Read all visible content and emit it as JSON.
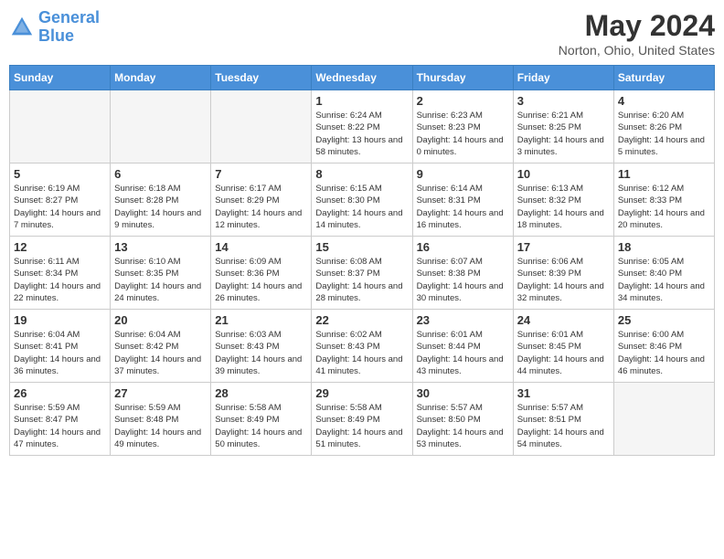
{
  "logo": {
    "line1": "General",
    "line2": "Blue"
  },
  "title": "May 2024",
  "location": "Norton, Ohio, United States",
  "headers": [
    "Sunday",
    "Monday",
    "Tuesday",
    "Wednesday",
    "Thursday",
    "Friday",
    "Saturday"
  ],
  "weeks": [
    [
      {
        "day": "",
        "sunrise": "",
        "sunset": "",
        "daylight": "",
        "empty": true
      },
      {
        "day": "",
        "sunrise": "",
        "sunset": "",
        "daylight": "",
        "empty": true
      },
      {
        "day": "",
        "sunrise": "",
        "sunset": "",
        "daylight": "",
        "empty": true
      },
      {
        "day": "1",
        "sunrise": "Sunrise: 6:24 AM",
        "sunset": "Sunset: 8:22 PM",
        "daylight": "Daylight: 13 hours and 58 minutes."
      },
      {
        "day": "2",
        "sunrise": "Sunrise: 6:23 AM",
        "sunset": "Sunset: 8:23 PM",
        "daylight": "Daylight: 14 hours and 0 minutes."
      },
      {
        "day": "3",
        "sunrise": "Sunrise: 6:21 AM",
        "sunset": "Sunset: 8:25 PM",
        "daylight": "Daylight: 14 hours and 3 minutes."
      },
      {
        "day": "4",
        "sunrise": "Sunrise: 6:20 AM",
        "sunset": "Sunset: 8:26 PM",
        "daylight": "Daylight: 14 hours and 5 minutes."
      }
    ],
    [
      {
        "day": "5",
        "sunrise": "Sunrise: 6:19 AM",
        "sunset": "Sunset: 8:27 PM",
        "daylight": "Daylight: 14 hours and 7 minutes."
      },
      {
        "day": "6",
        "sunrise": "Sunrise: 6:18 AM",
        "sunset": "Sunset: 8:28 PM",
        "daylight": "Daylight: 14 hours and 9 minutes."
      },
      {
        "day": "7",
        "sunrise": "Sunrise: 6:17 AM",
        "sunset": "Sunset: 8:29 PM",
        "daylight": "Daylight: 14 hours and 12 minutes."
      },
      {
        "day": "8",
        "sunrise": "Sunrise: 6:15 AM",
        "sunset": "Sunset: 8:30 PM",
        "daylight": "Daylight: 14 hours and 14 minutes."
      },
      {
        "day": "9",
        "sunrise": "Sunrise: 6:14 AM",
        "sunset": "Sunset: 8:31 PM",
        "daylight": "Daylight: 14 hours and 16 minutes."
      },
      {
        "day": "10",
        "sunrise": "Sunrise: 6:13 AM",
        "sunset": "Sunset: 8:32 PM",
        "daylight": "Daylight: 14 hours and 18 minutes."
      },
      {
        "day": "11",
        "sunrise": "Sunrise: 6:12 AM",
        "sunset": "Sunset: 8:33 PM",
        "daylight": "Daylight: 14 hours and 20 minutes."
      }
    ],
    [
      {
        "day": "12",
        "sunrise": "Sunrise: 6:11 AM",
        "sunset": "Sunset: 8:34 PM",
        "daylight": "Daylight: 14 hours and 22 minutes."
      },
      {
        "day": "13",
        "sunrise": "Sunrise: 6:10 AM",
        "sunset": "Sunset: 8:35 PM",
        "daylight": "Daylight: 14 hours and 24 minutes."
      },
      {
        "day": "14",
        "sunrise": "Sunrise: 6:09 AM",
        "sunset": "Sunset: 8:36 PM",
        "daylight": "Daylight: 14 hours and 26 minutes."
      },
      {
        "day": "15",
        "sunrise": "Sunrise: 6:08 AM",
        "sunset": "Sunset: 8:37 PM",
        "daylight": "Daylight: 14 hours and 28 minutes."
      },
      {
        "day": "16",
        "sunrise": "Sunrise: 6:07 AM",
        "sunset": "Sunset: 8:38 PM",
        "daylight": "Daylight: 14 hours and 30 minutes."
      },
      {
        "day": "17",
        "sunrise": "Sunrise: 6:06 AM",
        "sunset": "Sunset: 8:39 PM",
        "daylight": "Daylight: 14 hours and 32 minutes."
      },
      {
        "day": "18",
        "sunrise": "Sunrise: 6:05 AM",
        "sunset": "Sunset: 8:40 PM",
        "daylight": "Daylight: 14 hours and 34 minutes."
      }
    ],
    [
      {
        "day": "19",
        "sunrise": "Sunrise: 6:04 AM",
        "sunset": "Sunset: 8:41 PM",
        "daylight": "Daylight: 14 hours and 36 minutes."
      },
      {
        "day": "20",
        "sunrise": "Sunrise: 6:04 AM",
        "sunset": "Sunset: 8:42 PM",
        "daylight": "Daylight: 14 hours and 37 minutes."
      },
      {
        "day": "21",
        "sunrise": "Sunrise: 6:03 AM",
        "sunset": "Sunset: 8:43 PM",
        "daylight": "Daylight: 14 hours and 39 minutes."
      },
      {
        "day": "22",
        "sunrise": "Sunrise: 6:02 AM",
        "sunset": "Sunset: 8:43 PM",
        "daylight": "Daylight: 14 hours and 41 minutes."
      },
      {
        "day": "23",
        "sunrise": "Sunrise: 6:01 AM",
        "sunset": "Sunset: 8:44 PM",
        "daylight": "Daylight: 14 hours and 43 minutes."
      },
      {
        "day": "24",
        "sunrise": "Sunrise: 6:01 AM",
        "sunset": "Sunset: 8:45 PM",
        "daylight": "Daylight: 14 hours and 44 minutes."
      },
      {
        "day": "25",
        "sunrise": "Sunrise: 6:00 AM",
        "sunset": "Sunset: 8:46 PM",
        "daylight": "Daylight: 14 hours and 46 minutes."
      }
    ],
    [
      {
        "day": "26",
        "sunrise": "Sunrise: 5:59 AM",
        "sunset": "Sunset: 8:47 PM",
        "daylight": "Daylight: 14 hours and 47 minutes."
      },
      {
        "day": "27",
        "sunrise": "Sunrise: 5:59 AM",
        "sunset": "Sunset: 8:48 PM",
        "daylight": "Daylight: 14 hours and 49 minutes."
      },
      {
        "day": "28",
        "sunrise": "Sunrise: 5:58 AM",
        "sunset": "Sunset: 8:49 PM",
        "daylight": "Daylight: 14 hours and 50 minutes."
      },
      {
        "day": "29",
        "sunrise": "Sunrise: 5:58 AM",
        "sunset": "Sunset: 8:49 PM",
        "daylight": "Daylight: 14 hours and 51 minutes."
      },
      {
        "day": "30",
        "sunrise": "Sunrise: 5:57 AM",
        "sunset": "Sunset: 8:50 PM",
        "daylight": "Daylight: 14 hours and 53 minutes."
      },
      {
        "day": "31",
        "sunrise": "Sunrise: 5:57 AM",
        "sunset": "Sunset: 8:51 PM",
        "daylight": "Daylight: 14 hours and 54 minutes."
      },
      {
        "day": "",
        "sunrise": "",
        "sunset": "",
        "daylight": "",
        "empty": true
      }
    ]
  ]
}
